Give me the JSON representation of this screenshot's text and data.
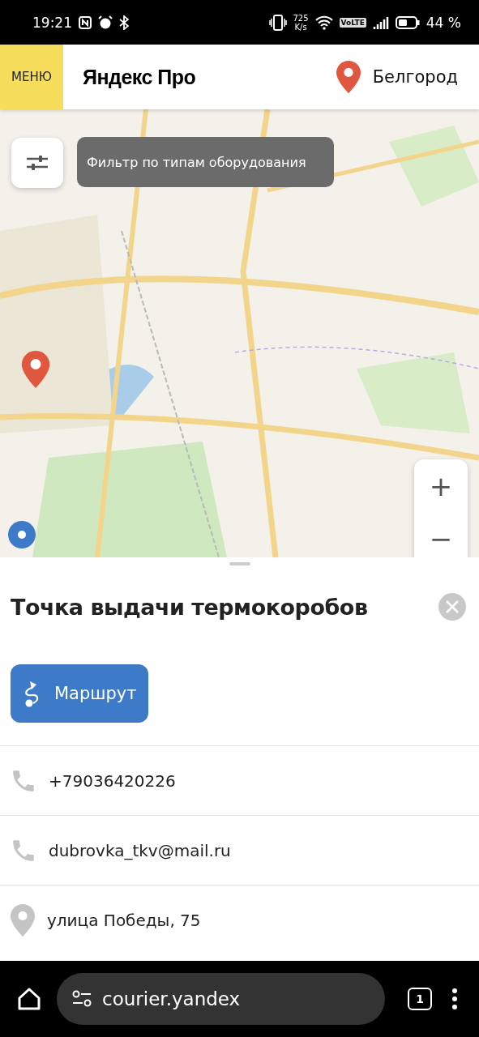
{
  "status_bar": {
    "time": "19:21",
    "speed_value": "725",
    "speed_unit": "K/s",
    "network_badge": "VoLTE",
    "battery": "44 %"
  },
  "header": {
    "menu_label": "МЕНЮ",
    "title": "Яндекс Про",
    "city": "Белгород"
  },
  "map": {
    "kind": "picture",
    "filter_tooltip": "Фильтр по типам оборудования",
    "zoom_in": "+",
    "zoom_out": "−"
  },
  "sheet": {
    "title": "Точка выдачи термокоробов",
    "route_button": "Маршрут",
    "contacts": [
      {
        "kind": "phone",
        "text": "+79036420226"
      },
      {
        "kind": "phone",
        "text": "dubrovka_tkv@mail.ru"
      },
      {
        "kind": "address",
        "text": "улица Победы, 75"
      }
    ]
  },
  "browser_bar": {
    "url": "courier.yandex",
    "tab_count": "1"
  }
}
